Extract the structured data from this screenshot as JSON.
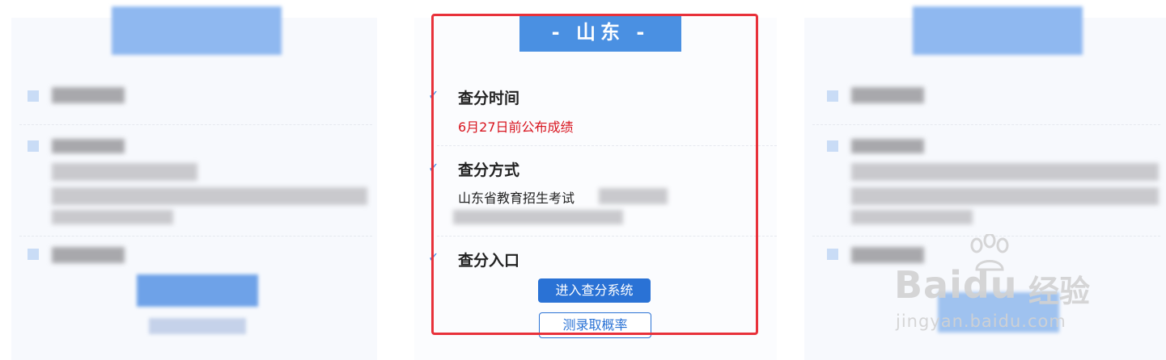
{
  "center_card": {
    "province_title": "- 山东 -",
    "sections": [
      {
        "heading": "查分时间",
        "value": "6月27日前公布成绩"
      },
      {
        "heading": "查分方式",
        "value": "山东省教育招生考试"
      },
      {
        "heading": "查分入口"
      }
    ],
    "primary_button": "进入查分系统",
    "secondary_button": "测录取概率"
  },
  "watermark": {
    "logo_text": "Baidu",
    "brand_cn": "经验",
    "url": "jingyan.baidu.com"
  },
  "colors": {
    "accent": "#4a90e2",
    "button_blue": "#2a72d5",
    "highlight_red": "#d8141e",
    "frame_red": "#e8313a"
  },
  "icons": [
    "check-icon",
    "baidu-paw-icon"
  ]
}
